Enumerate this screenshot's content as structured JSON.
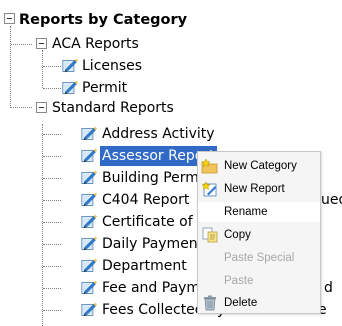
{
  "tree": {
    "root_label": "Reports by Category",
    "groups": [
      {
        "label": "ACA Reports",
        "items": [
          "Licenses",
          "Permit"
        ]
      },
      {
        "label": "Standard Reports",
        "items": [
          "Address Activity",
          "Assessor Report",
          "Building Permits",
          "C404 Report",
          "Certificate of",
          "Daily Payment",
          "Department",
          "Fee and Payment",
          "Fees Collected by Account Code"
        ]
      }
    ],
    "partial_suffixes": {
      "c404": "ued",
      "fee_payment": "d"
    }
  },
  "context_menu": {
    "items": [
      {
        "label": "New Category",
        "icon": "new-category-icon",
        "state": "enabled"
      },
      {
        "label": "New Report",
        "icon": "new-report-icon",
        "state": "enabled"
      },
      {
        "label": "Rename",
        "icon": "",
        "state": "highlighted"
      },
      {
        "label": "Copy",
        "icon": "copy-icon",
        "state": "enabled"
      },
      {
        "label": "Paste Special",
        "icon": "",
        "state": "disabled"
      },
      {
        "label": "Paste",
        "icon": "",
        "state": "disabled"
      },
      {
        "label": "Delete",
        "icon": "trash-icon",
        "state": "enabled"
      }
    ]
  },
  "colors": {
    "selection": "#3169c6",
    "menu_bg": "#f5f5f5",
    "menu_border": "#c8c8c8",
    "disabled_text": "#a8a8a8"
  }
}
